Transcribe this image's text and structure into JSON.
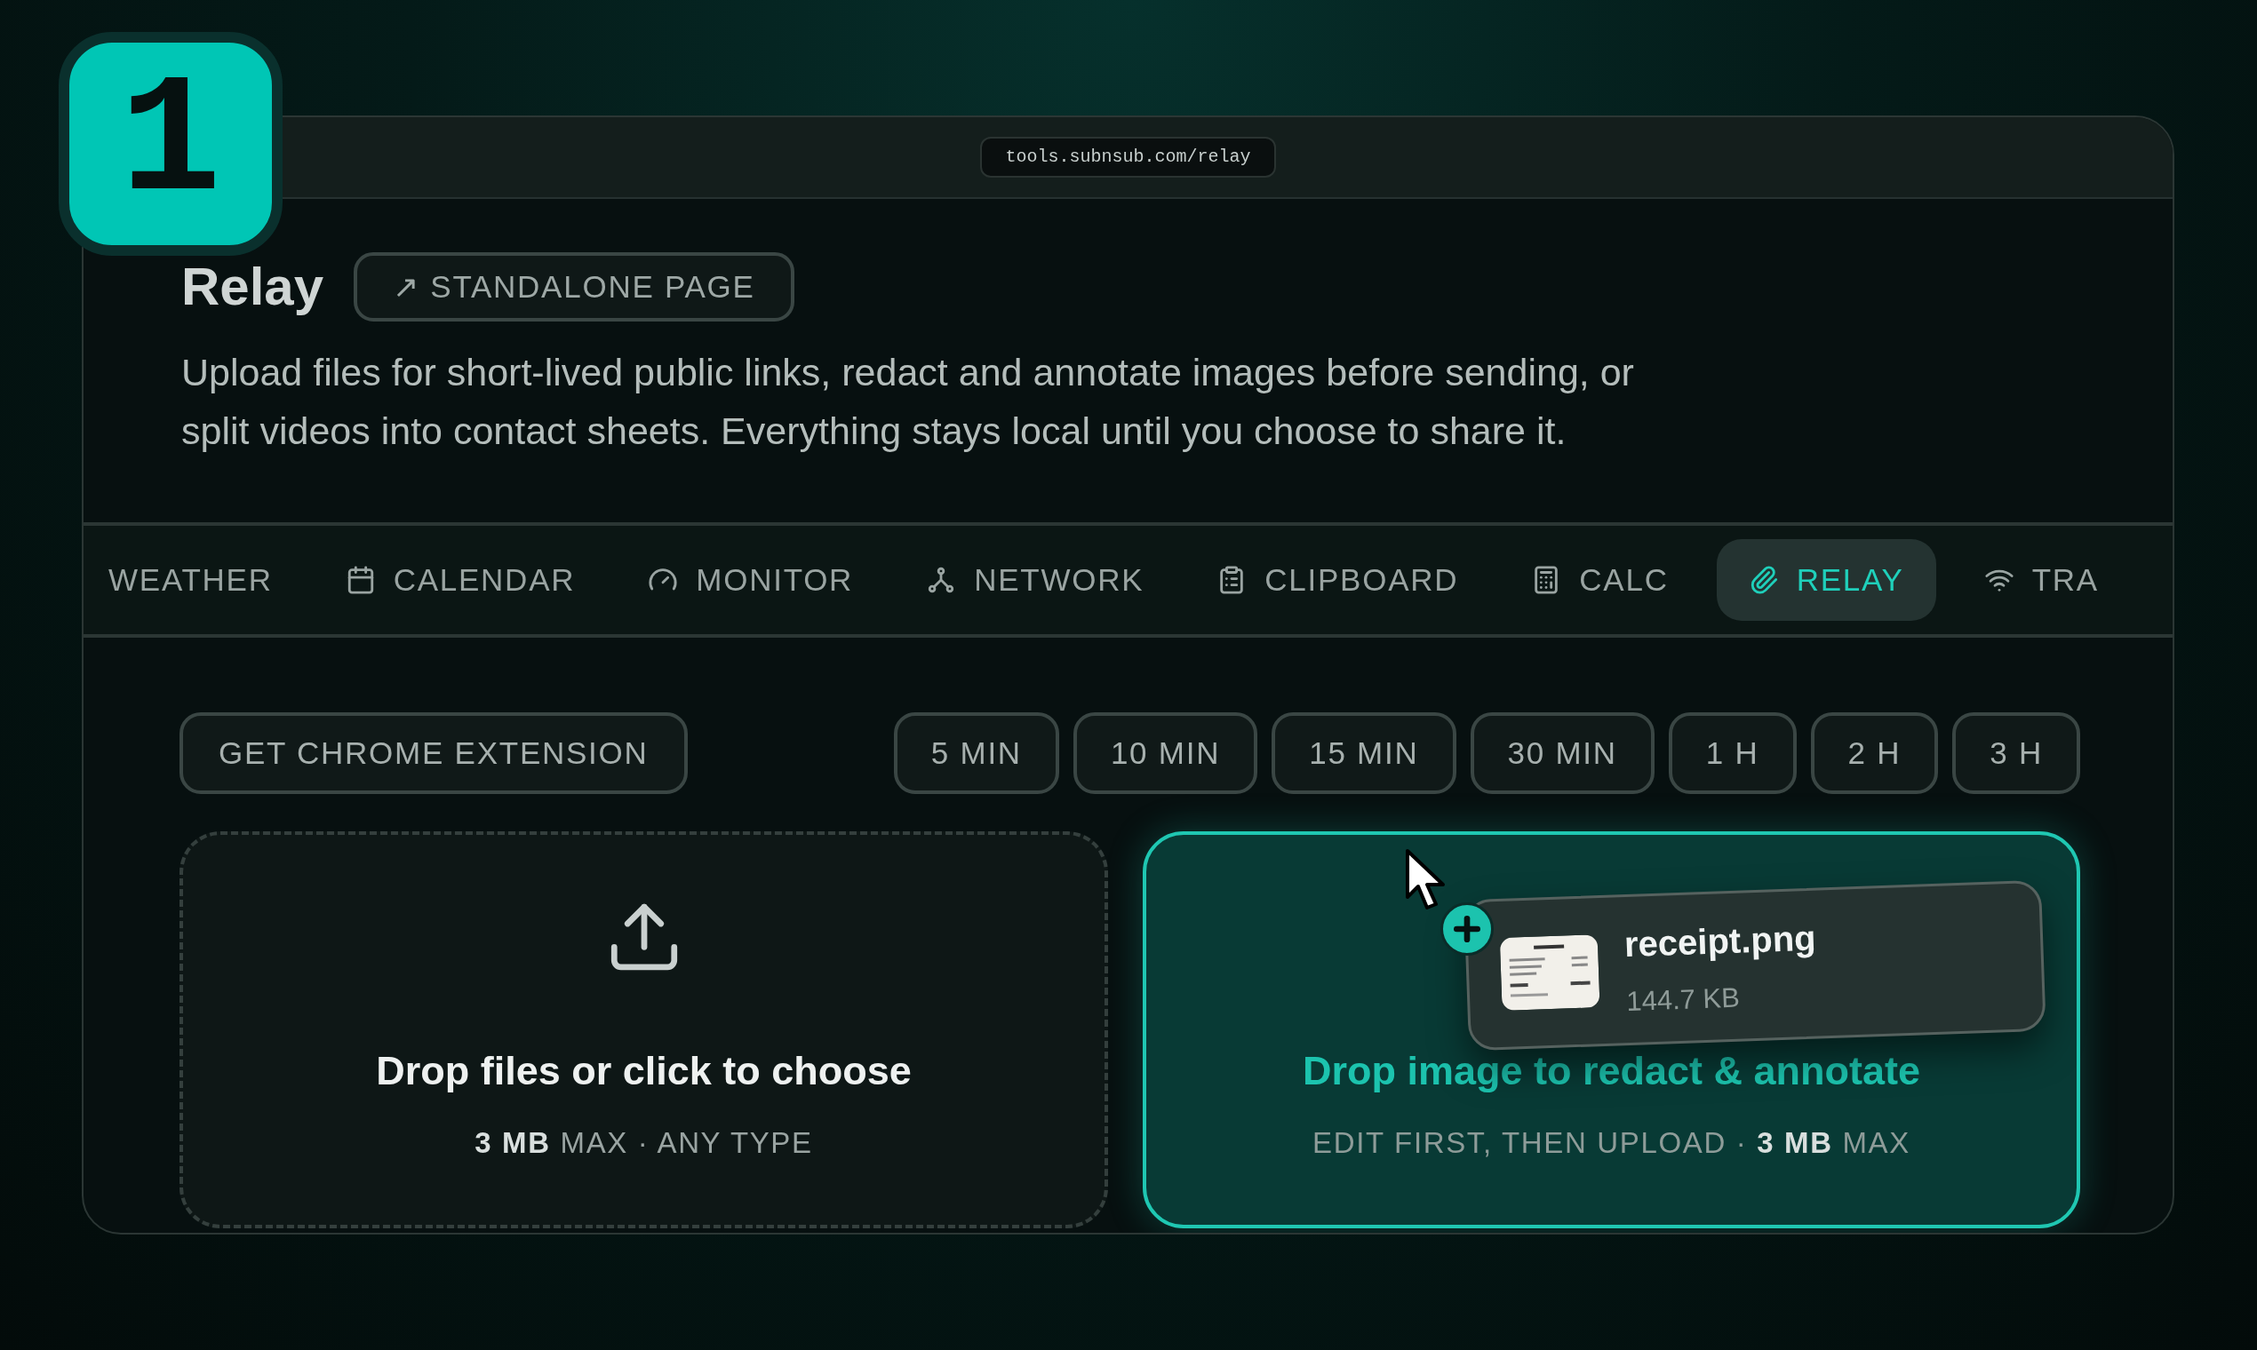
{
  "step_badge": "1",
  "browser": {
    "url": "tools.subnsub.com/relay"
  },
  "header": {
    "title": "Relay",
    "standalone_button": "↗ STANDALONE PAGE",
    "description": "Upload files for short-lived public links, redact and annotate images before sending, or split videos into contact sheets. Everything stays local until you choose to share it."
  },
  "tabs": [
    {
      "label": "WEATHER",
      "selected": false
    },
    {
      "label": "CALENDAR",
      "selected": false
    },
    {
      "label": "MONITOR",
      "selected": false
    },
    {
      "label": "NETWORK",
      "selected": false
    },
    {
      "label": "CLIPBOARD",
      "selected": false
    },
    {
      "label": "CALC",
      "selected": false
    },
    {
      "label": "RELAY",
      "selected": true
    },
    {
      "label": "TRA",
      "selected": false
    }
  ],
  "extension_button": "GET CHROME EXTENSION",
  "durations": [
    "5 MIN",
    "10 MIN",
    "15 MIN",
    "30 MIN",
    "1 H",
    "2 H",
    "3 H"
  ],
  "drop_zones": [
    {
      "kind": "upload",
      "title": "Drop files or click to choose",
      "subtitle": "**3 MB** MAX · ANY TYPE",
      "active": false
    },
    {
      "kind": "redact",
      "title": "Drop image to redact & annotate",
      "subtitle": "EDIT FIRST, THEN UPLOAD · **3 MB** MAX",
      "active": true
    }
  ],
  "dragged_file": {
    "name": "receipt.png",
    "size": "144.7 KB"
  }
}
